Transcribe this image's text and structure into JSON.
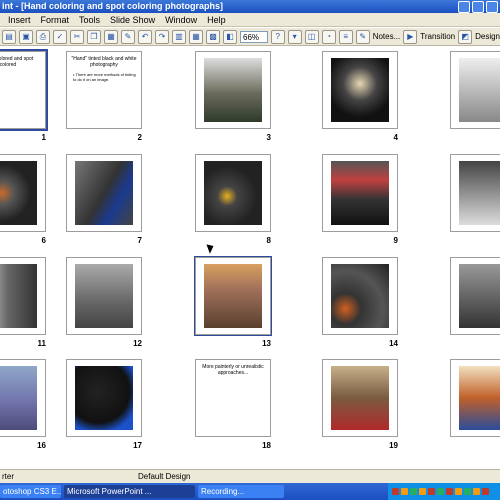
{
  "window": {
    "title": "int - [Hand coloring and spot coloring photographs]"
  },
  "menu": {
    "items": [
      "Insert",
      "Format",
      "Tools",
      "Slide Show",
      "Window",
      "Help"
    ]
  },
  "toolbar": {
    "zoom": "66%",
    "notes": "Notes...",
    "transition": "Transition",
    "design": "Design"
  },
  "slides": [
    {
      "num": "1",
      "kind": "text",
      "text": "Hand colored and spot colored"
    },
    {
      "num": "2",
      "kind": "text",
      "text": "\"Hand\" tinted black and white photography",
      "bullet": "There are more methods of tinting to do it on an image."
    },
    {
      "num": "3",
      "kind": "photo"
    },
    {
      "num": "4",
      "kind": "photo"
    },
    {
      "num": "",
      "kind": "photo"
    },
    {
      "num": "6",
      "kind": "photo"
    },
    {
      "num": "7",
      "kind": "photo"
    },
    {
      "num": "8",
      "kind": "photo"
    },
    {
      "num": "9",
      "kind": "photo"
    },
    {
      "num": "",
      "kind": "photo"
    },
    {
      "num": "11",
      "kind": "photo"
    },
    {
      "num": "12",
      "kind": "photo"
    },
    {
      "num": "13",
      "kind": "photo"
    },
    {
      "num": "14",
      "kind": "photo"
    },
    {
      "num": "",
      "kind": "photo"
    },
    {
      "num": "16",
      "kind": "photo"
    },
    {
      "num": "17",
      "kind": "photo"
    },
    {
      "num": "18",
      "kind": "text",
      "text": "More painterly or unrealistic approaches..."
    },
    {
      "num": "19",
      "kind": "photo"
    },
    {
      "num": "",
      "kind": "photo"
    }
  ],
  "status": {
    "view": "rter",
    "design": "Default Design"
  },
  "taskbar": {
    "items": [
      "otoshop CS3 E...",
      "Microsoft PowerPoint ...",
      "Recording..."
    ]
  },
  "colors": {
    "selection": "#304a9d",
    "titlebar": "#1b4fc1"
  }
}
